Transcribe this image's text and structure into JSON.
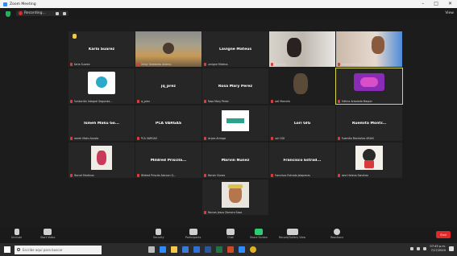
{
  "window": {
    "title": "Zoom Meeting",
    "controls": [
      "–",
      "□",
      "✕"
    ]
  },
  "topbar": {
    "recording_label": "Recording...",
    "view_label": "View"
  },
  "tiles": [
    {
      "big": "Karla Suarez",
      "small": "Karla Suarez",
      "kind": "name"
    },
    {
      "big": "",
      "small": "Dinay Goddards Andreu",
      "kind": "video"
    },
    {
      "big": "Lavigne Mateus",
      "small": "Lavigne Mateus",
      "kind": "name"
    },
    {
      "big": "",
      "small": "Ana Ruiz",
      "kind": "video"
    },
    {
      "big": "",
      "small": "Gloria Mira Silva",
      "kind": "video"
    },
    {
      "big": "",
      "small": "Fundación Integral Segunda...",
      "kind": "logo"
    },
    {
      "big": "jq_prez",
      "small": "jq_prez",
      "kind": "name"
    },
    {
      "big": "Rosa Mary Perez",
      "small": "Rosa Mary Perez",
      "kind": "name"
    },
    {
      "big": "",
      "small": "Jodi Marcela",
      "kind": "video"
    },
    {
      "big": "",
      "small": "Edilma Arboleda Maquin",
      "kind": "logo-active"
    },
    {
      "big": "Ismeh Maku Go...",
      "small": "Ismeh Maku Acosta",
      "kind": "name"
    },
    {
      "big": "PCA VARGAS",
      "small": "PCA VARGAS",
      "kind": "name"
    },
    {
      "big": "",
      "small": "Jarpes Arriaga",
      "kind": "logo"
    },
    {
      "big": "Lori GIG",
      "small": "Lori GIG",
      "kind": "name"
    },
    {
      "big": "Ruemita Montr...",
      "small": "Ruemita Montañez ARIAS",
      "kind": "name"
    },
    {
      "big": "",
      "small": "Marcel Martinez",
      "kind": "video"
    },
    {
      "big": "Mildred Priscila...",
      "small": "Mildred Priscila Alarcon Q...",
      "kind": "name"
    },
    {
      "big": "Marvin Nunez",
      "small": "Marvin Nunez",
      "kind": "name"
    },
    {
      "big": "Francisco Estrad...",
      "small": "Francisco Estrada Jalapenas",
      "kind": "name"
    },
    {
      "big": "",
      "small": "Jane Helena Sanchez",
      "kind": "logo"
    },
    {
      "big": "",
      "small": "Marcos Jesus Zamora Sosa",
      "kind": "video"
    }
  ],
  "toolbar": {
    "items": [
      "Unmute",
      "Start Video",
      "Security",
      "Participants",
      "Chat",
      "Share Screen",
      "Record/Gallery View",
      "Reactions"
    ],
    "end_label": "End"
  },
  "taskbar": {
    "search_placeholder": "Escribe aquí para buscar",
    "time": "07:45 p.m.",
    "date": "7/17/2020"
  },
  "colors": {
    "end_red": "#e02828",
    "active_outline": "#d9d94a",
    "mic_muted": "#e03a3a",
    "share_green": "#2ecc71"
  }
}
